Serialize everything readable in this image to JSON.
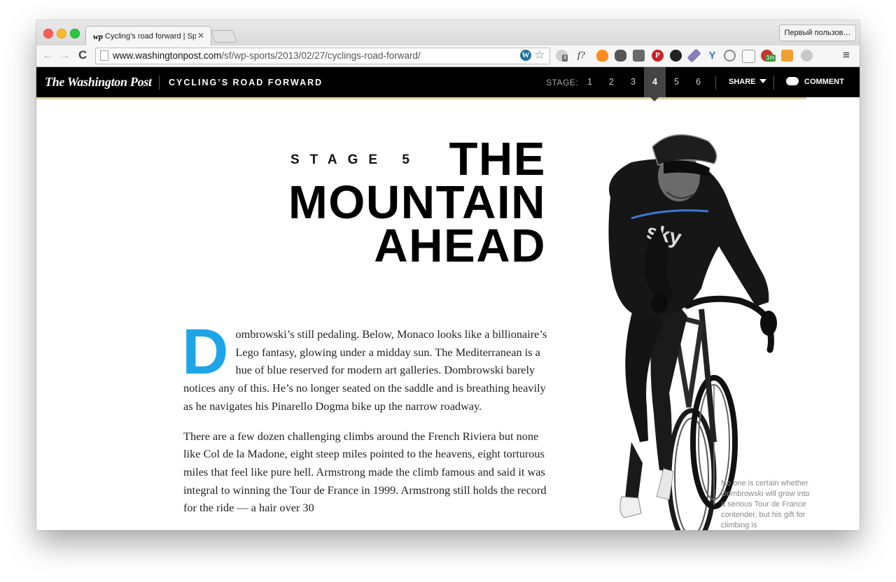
{
  "browser": {
    "tab_title": "Cycling’s road forward | Sp",
    "tab_favicon": "wp",
    "close_glyph": "✕",
    "profile_label": "Первый пользов…",
    "url_host": "www.washingtonpost.com",
    "url_path": "/sf/wp-sports/2013/02/27/cyclings-road-forward/",
    "back_icon": "←",
    "forward_icon": "→",
    "reload_icon": "C",
    "star_icon": "☆",
    "menu_icon": "≡",
    "extension_badges": [
      "8",
      "1m"
    ],
    "fontello_icon": "f?"
  },
  "header": {
    "logo": "The Washington Post",
    "series_title": "CYCLING’S ROAD FORWARD",
    "stage_label": "STAGE:",
    "stages": [
      "1",
      "2",
      "3",
      "4",
      "5",
      "6"
    ],
    "active_stage": "4",
    "share_label": "SHARE",
    "comment_label": "COMMENT"
  },
  "article": {
    "kicker": "STAGE 5",
    "headline_lines": [
      "THE",
      "MOUNTAIN",
      "AHEAD"
    ],
    "dropcap": "D",
    "paragraph1": "ombrowski’s still pedaling. Below, Monaco looks like a billionaire’s Lego fantasy, glowing under a midday sun. The Mediterranean is a hue of blue reserved for modern art galleries. Dombrowski barely notices any of this. He’s no longer seated on the saddle and is breathing heavily as he navigates his Pinarello Dogma bike up the narrow roadway.",
    "paragraph2": "There are a few dozen challenging climbs around the French Riviera but none like Col de la Madone, eight steep miles pointed to the heavens, eight torturous miles that feel like pure hell. Armstrong made the climb famous and said it was integral to winning the Tour de France in 1999. Armstrong still holds the record for the ride — a hair over 30",
    "photo_caption": "No one is certain whether Dombrowski will grow into a serious Tour de France contender, but his gift for climbing is",
    "jersey_text": "sky"
  },
  "colors": {
    "dropcap": "#1ea5e8",
    "header_bg": "#000000",
    "active_stage_bg": "#444444",
    "header_rule": "#d8d0a0"
  }
}
